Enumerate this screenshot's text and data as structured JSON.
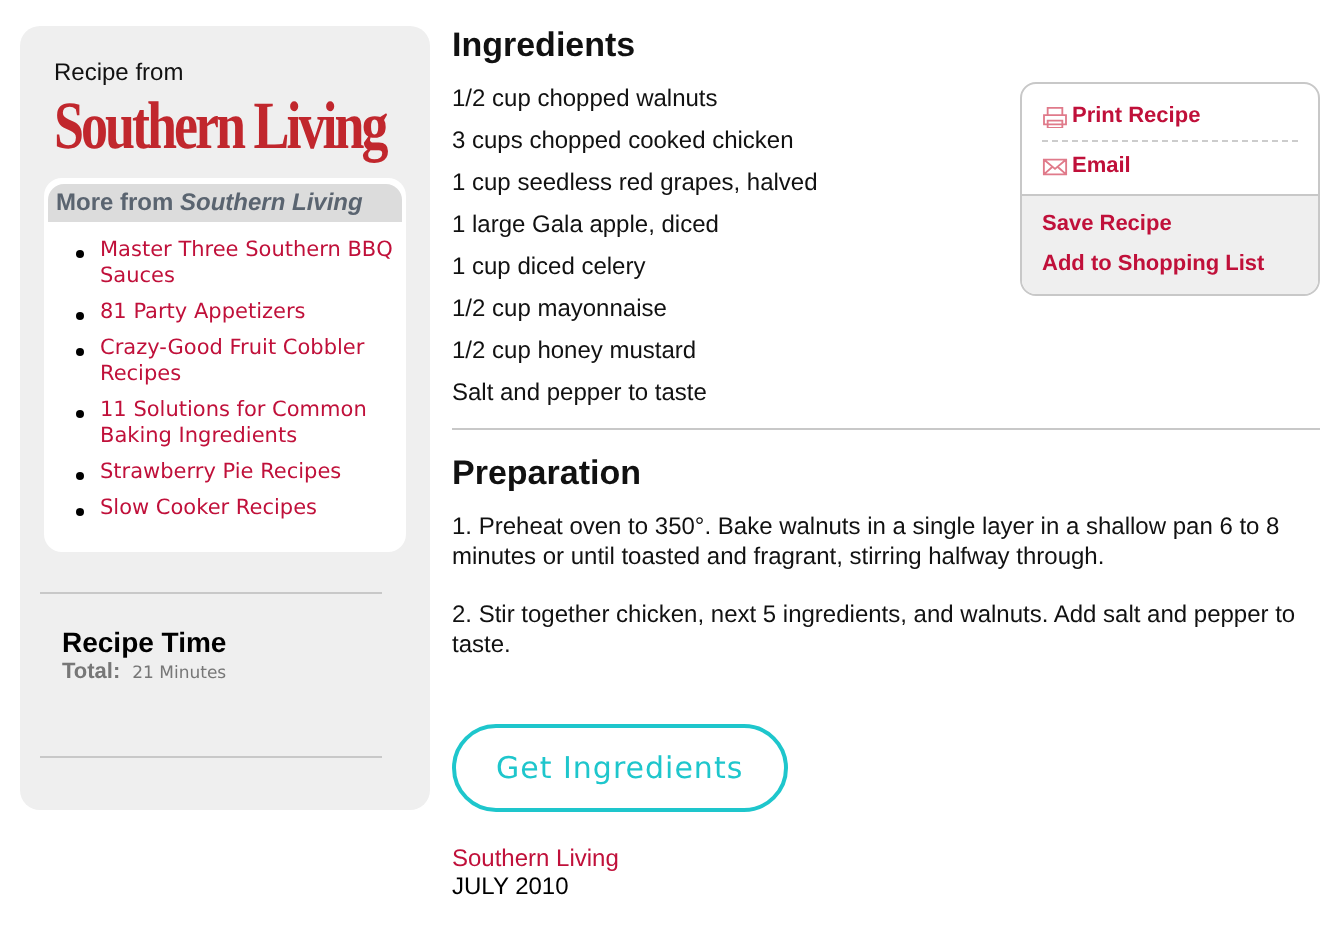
{
  "sidebar": {
    "source_label": "Recipe from",
    "brand": "Southern Living",
    "more_heading": "More from *Southern Living*",
    "more_links": [
      "Master Three Southern BBQ Sauces",
      "81 Party Appetizers",
      "Crazy-Good Fruit Cobbler Recipes",
      "11 Solutions for Common Baking Ingredients",
      "Strawberry Pie Recipes",
      "Slow Cooker Recipes"
    ],
    "recipe_time": {
      "title": "Recipe Time",
      "total_label": "Total:",
      "total_value": "21 Minutes"
    }
  },
  "ingredients": {
    "title": "Ingredients",
    "items": [
      "1/2 cup chopped walnuts",
      "3 cups chopped cooked chicken",
      "1 cup seedless red grapes, halved",
      "1 large Gala apple, diced",
      "1 cup diced celery",
      "1/2 cup mayonnaise",
      "1/2 cup honey mustard",
      "Salt and pepper to taste"
    ]
  },
  "actions": [
    {
      "kind": "print",
      "label": "Print Recipe"
    },
    {
      "kind": "email",
      "label": "Email"
    },
    {
      "kind": "save",
      "label": "Save Recipe"
    },
    {
      "kind": "list",
      "label": "Add to Shopping List"
    }
  ],
  "preparation": {
    "title": "Preparation",
    "steps": [
      "1. Preheat oven to 350°. Bake walnuts in a single layer in a shallow pan 6 to 8 minutes or until toasted and fragrant, stirring halfway through.",
      "2. Stir together chicken, next 5 ingredients, and walnuts. Add salt and pepper to taste."
    ]
  },
  "get_ingredients_button": "Get Ingredients",
  "footer": {
    "source": "Southern Living",
    "date": "JULY 2010"
  }
}
